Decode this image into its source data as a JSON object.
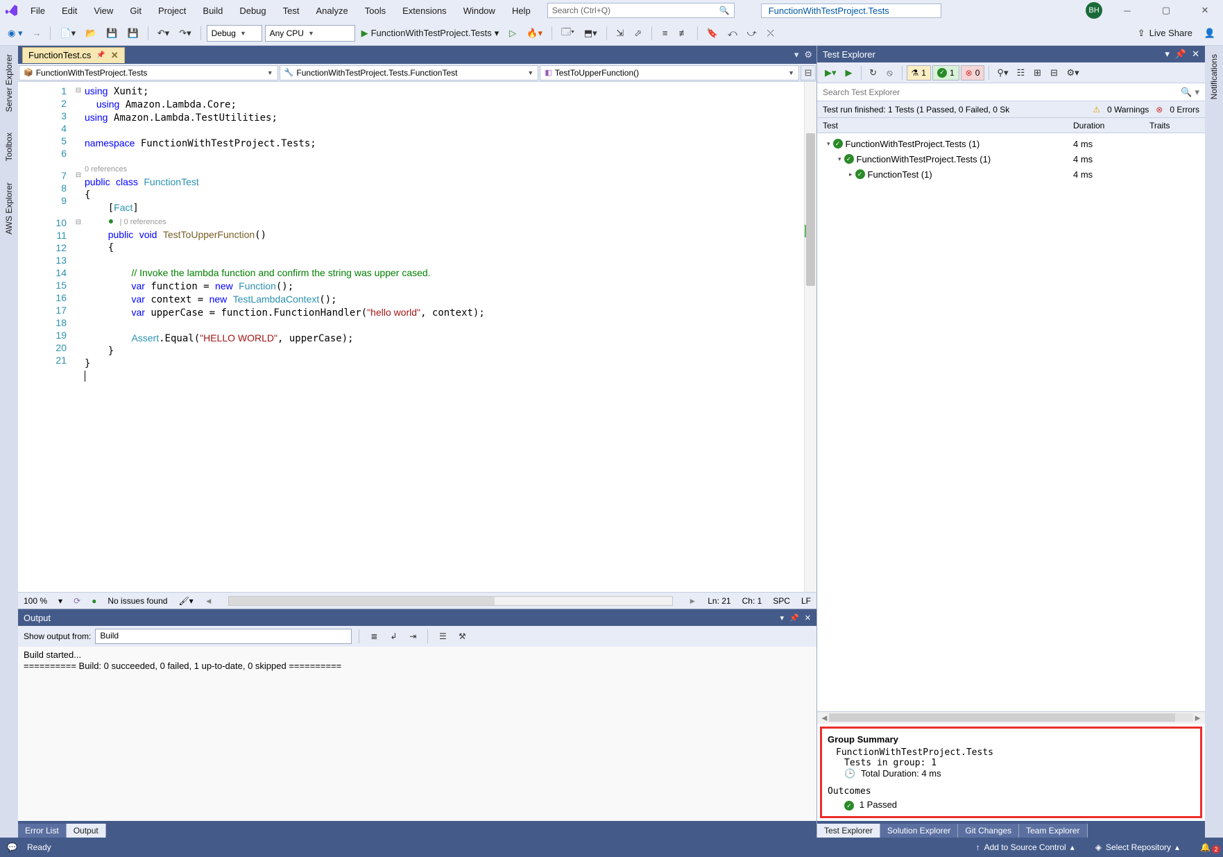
{
  "title": {
    "search_placeholder": "Search (Ctrl+Q)",
    "project": "FunctionWithTestProject.Tests",
    "avatar": "BH"
  },
  "menu": [
    "File",
    "Edit",
    "View",
    "Git",
    "Project",
    "Build",
    "Debug",
    "Test",
    "Analyze",
    "Tools",
    "Extensions",
    "Window",
    "Help"
  ],
  "toolbar": {
    "config": "Debug",
    "platform": "Any CPU",
    "run_target": "FunctionWithTestProject.Tests",
    "liveshare": "Live Share"
  },
  "doctab": {
    "name": "FunctionTest.cs"
  },
  "nav": {
    "project": "FunctionWithTestProject.Tests",
    "class": "FunctionWithTestProject.Tests.FunctionTest",
    "method": "TestToUpperFunction()"
  },
  "code": {
    "lines": 21,
    "ref0": "0 references",
    "ref1": "| 0 references"
  },
  "editor_status": {
    "zoom": "100 %",
    "issues": "No issues found",
    "ln": "Ln: 21",
    "ch": "Ch: 1",
    "spc": "SPC",
    "lf": "LF"
  },
  "output": {
    "header": "Output",
    "from_label": "Show output from:",
    "from": "Build",
    "line1": "Build started...",
    "line2": "========== Build: 0 succeeded, 0 failed, 1 up-to-date, 0 skipped =========="
  },
  "bottom_tabs": {
    "error": "Error List",
    "output": "Output"
  },
  "test_explorer": {
    "header": "Test Explorer",
    "counts": {
      "total": "1",
      "passed": "1",
      "failed": "0"
    },
    "search_placeholder": "Search Test Explorer",
    "info": "Test run finished: 1 Tests (1 Passed, 0 Failed, 0 Sk",
    "warnings": "0 Warnings",
    "errors": "0 Errors",
    "cols": {
      "test": "Test",
      "duration": "Duration",
      "traits": "Traits"
    },
    "rows": [
      {
        "indent": 14,
        "name": "FunctionWithTestProject.Tests  (1)",
        "dur": "4 ms"
      },
      {
        "indent": 30,
        "name": "FunctionWithTestProject.Tests  (1)",
        "dur": "4 ms"
      },
      {
        "indent": 46,
        "name": "FunctionTest  (1)",
        "dur": "4 ms"
      }
    ],
    "summary": {
      "title": "Group Summary",
      "name": "FunctionWithTestProject.Tests",
      "tests_label": "Tests in group: 1",
      "duration": "Total Duration: 4 ms",
      "outcomes": "Outcomes",
      "passed": "1 Passed"
    },
    "bottom_tabs": [
      "Test Explorer",
      "Solution Explorer",
      "Git Changes",
      "Team Explorer"
    ]
  },
  "side": {
    "server": "Server Explorer",
    "toolbox": "Toolbox",
    "aws": "AWS Explorer",
    "notif": "Notifications"
  },
  "status": {
    "ready": "Ready",
    "add_source": "Add to Source Control",
    "select_repo": "Select Repository",
    "bell_count": "2"
  }
}
